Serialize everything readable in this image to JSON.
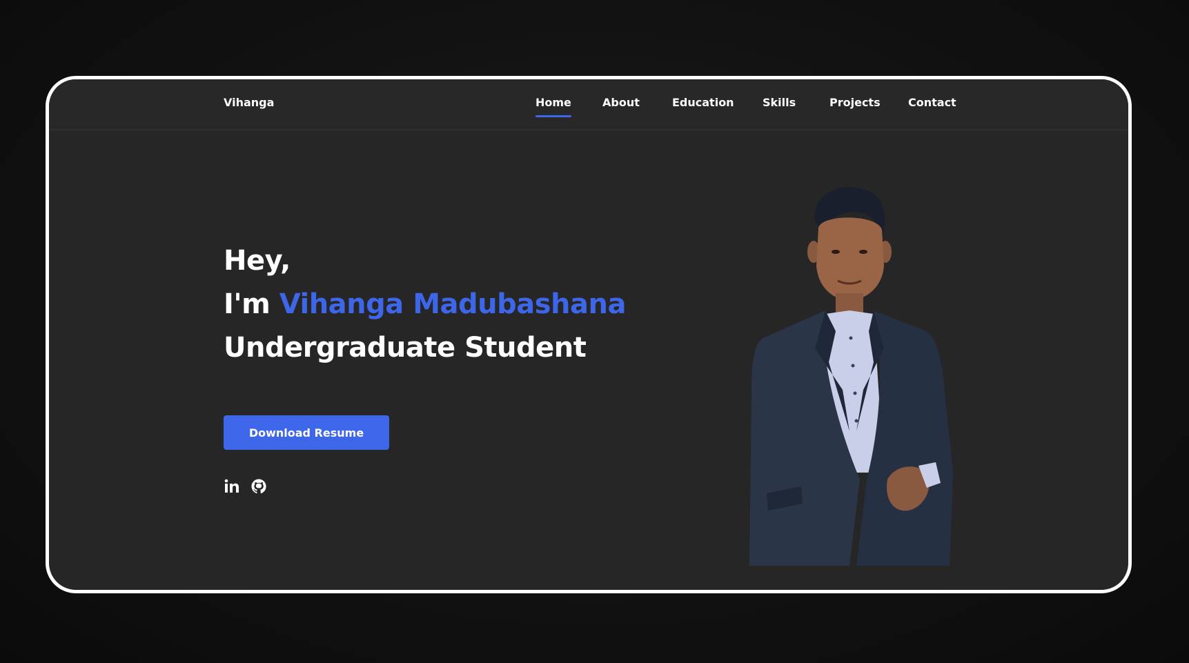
{
  "navbar": {
    "brand": "Vihanga",
    "items": [
      {
        "label": "Home",
        "active": true
      },
      {
        "label": "About",
        "active": false
      },
      {
        "label": "Education",
        "active": false
      },
      {
        "label": "Skills",
        "active": false
      },
      {
        "label": "Projects",
        "active": false
      },
      {
        "label": "Contact",
        "active": false
      }
    ]
  },
  "hero": {
    "greeting": "Hey,",
    "intro_prefix": "I'm ",
    "name": "Vihanga Madubashana",
    "role": "Undergraduate Student",
    "cta_label": "Download Resume"
  },
  "social": [
    {
      "icon": "linkedin-icon"
    },
    {
      "icon": "github-icon"
    }
  ],
  "colors": {
    "accent": "#3d66e8",
    "page_background": "#262626",
    "frame_border": "#ffffff"
  }
}
